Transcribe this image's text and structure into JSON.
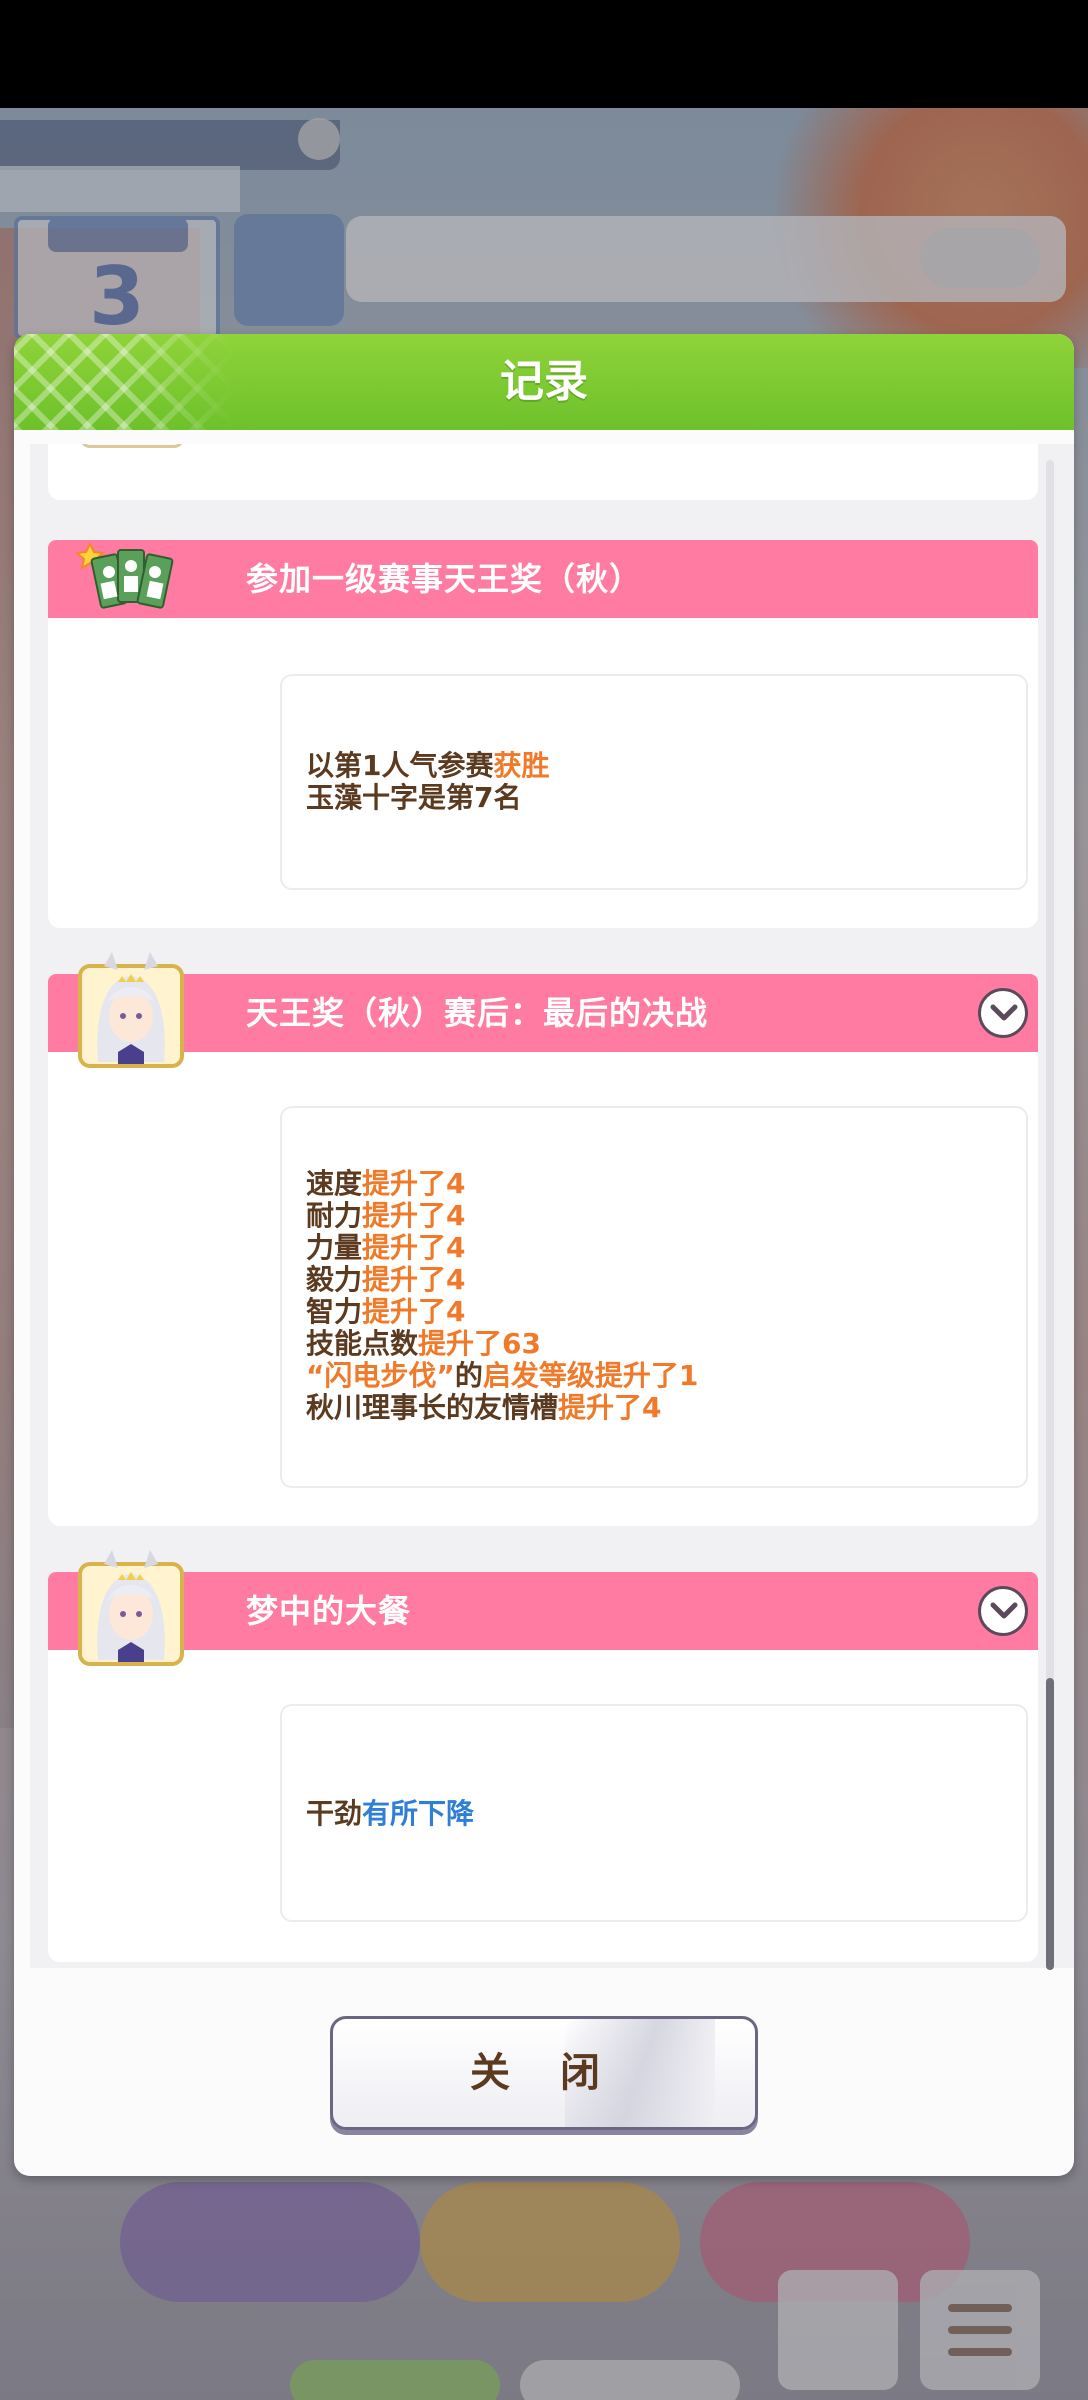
{
  "dialog": {
    "title": "记录",
    "close_label": "关 闭"
  },
  "background": {
    "turn_number": "3"
  },
  "entries": [
    {
      "title": "参加一级赛事天王奖（秋）",
      "icon": "race-cards-icon",
      "expandable": false,
      "lines": [
        {
          "parts": [
            {
              "t": "以第1人气参赛",
              "c": "normal"
            },
            {
              "t": "获胜",
              "c": "orange"
            }
          ]
        },
        {
          "parts": [
            {
              "t": "玉藻十字是第7名",
              "c": "normal"
            }
          ]
        }
      ]
    },
    {
      "title": "天王奖（秋）赛后：最后的决战",
      "icon": "character-portrait-icon",
      "expandable": true,
      "lines": [
        {
          "parts": [
            {
              "t": "速度",
              "c": "normal"
            },
            {
              "t": "提升了4",
              "c": "orange"
            }
          ]
        },
        {
          "parts": [
            {
              "t": "耐力",
              "c": "normal"
            },
            {
              "t": "提升了4",
              "c": "orange"
            }
          ]
        },
        {
          "parts": [
            {
              "t": "力量",
              "c": "normal"
            },
            {
              "t": "提升了4",
              "c": "orange"
            }
          ]
        },
        {
          "parts": [
            {
              "t": "毅力",
              "c": "normal"
            },
            {
              "t": "提升了4",
              "c": "orange"
            }
          ]
        },
        {
          "parts": [
            {
              "t": "智力",
              "c": "normal"
            },
            {
              "t": "提升了4",
              "c": "orange"
            }
          ]
        },
        {
          "parts": [
            {
              "t": "技能点数",
              "c": "normal"
            },
            {
              "t": "提升了63",
              "c": "orange"
            }
          ]
        },
        {
          "parts": [
            {
              "t": "“闪电步伐”",
              "c": "orange"
            },
            {
              "t": "的",
              "c": "normal"
            },
            {
              "t": "启发等级提升了1",
              "c": "orange"
            }
          ]
        },
        {
          "parts": [
            {
              "t": "秋川理事长的友情槽",
              "c": "normal"
            },
            {
              "t": "提升了4",
              "c": "orange"
            }
          ]
        }
      ]
    },
    {
      "title": "梦中的大餐",
      "icon": "character-portrait-icon",
      "expandable": true,
      "lines": [
        {
          "parts": [
            {
              "t": "干劲",
              "c": "normal"
            },
            {
              "t": "有所下降",
              "c": "blue"
            }
          ]
        }
      ]
    }
  ],
  "colors": {
    "header_green": "#7cc832",
    "card_pink": "#ff7ba1",
    "text_brown": "#5c3a1f",
    "highlight_orange": "#f07a29",
    "highlight_blue": "#2f7fd6"
  }
}
